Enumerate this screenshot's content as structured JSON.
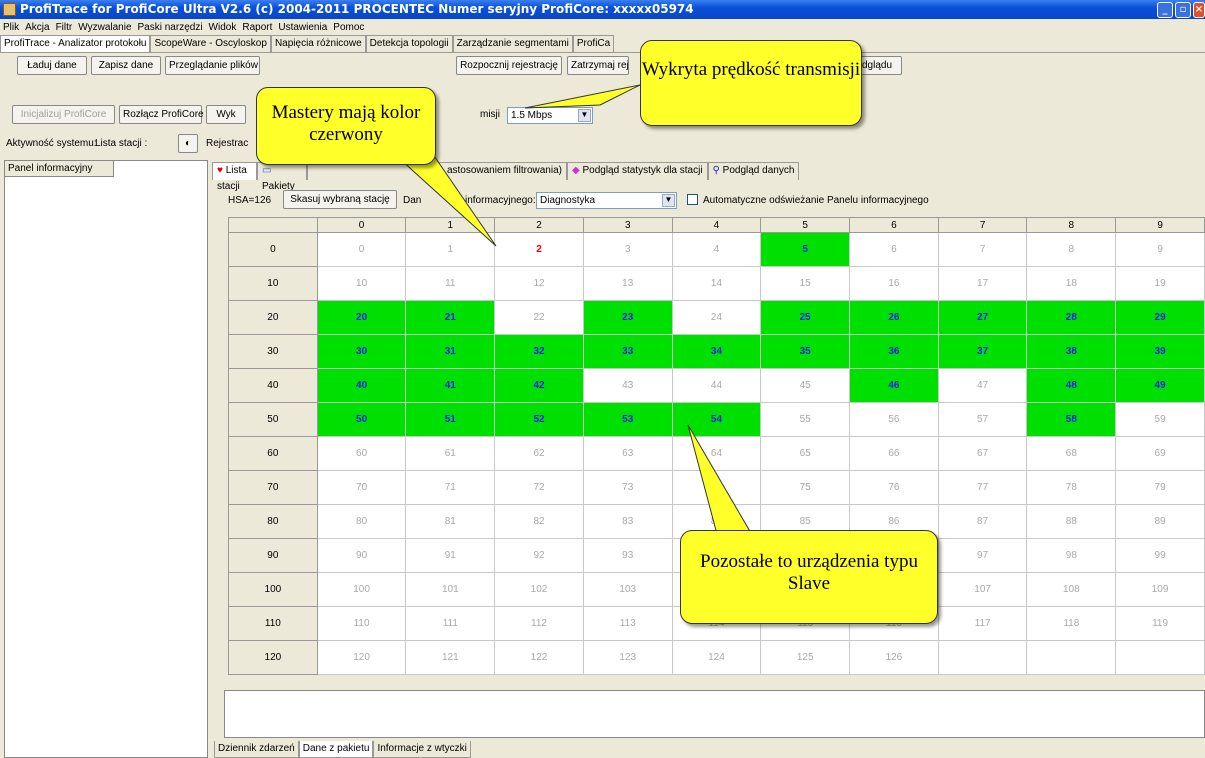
{
  "window": {
    "title": "ProfiTrace for ProfiCore Ultra V2.6 (c) 2004-2011 PROCENTEC  Numer seryjny ProfiCore: xxxxx05974"
  },
  "menu": [
    "Plik",
    "Akcja",
    "Filtr",
    "Wyzwalanie",
    "Paski narzędzi",
    "Widok",
    "Raport",
    "Ustawienia",
    "Pomoc"
  ],
  "tabs": [
    "ProfiTrace - Analizator protokołu",
    "ScopeWare - Oscyloskop",
    "Napięcia różnicowe",
    "Detekcja topologii",
    "Zarządzanie segmentami",
    "ProfiCa"
  ],
  "toolbar1": {
    "load": "Ładuj dane",
    "save": "Zapisz dane",
    "browse": "Przeglądanie plików",
    "start": "Rozpocznij rejestrację",
    "stop": "Zatrzymaj rej",
    "view": "dglądu"
  },
  "toolbar2": {
    "init": "Inicjalizuj ProfiCore",
    "disconnect": "Rozłącz ProfiCore",
    "wy": "Wyk",
    "misji": "misji",
    "speed": "1.5 Mbps"
  },
  "status": {
    "activity": "Aktywność systemu:",
    "stations": "Lista stacji :",
    "reg": "Rejestrac"
  },
  "leftpanel": {
    "title": "Panel informacyjny"
  },
  "subtabs": {
    "stations": "Lista stacji",
    "packets": "Pakiety",
    "filtered": "astosowaniem filtrowania)",
    "stats": "Podgląd statystyk dla stacji",
    "data": "Podgląd danych"
  },
  "hsa": {
    "label": "HSA=126",
    "delete": "Skasuj wybraną stację",
    "info_a": "Dan",
    "info_b": "informacyjnego:",
    "mode": "Diagnostyka",
    "auto": "Automatyczne odświeżanie Panelu informacyjnego"
  },
  "grid": {
    "col_headers": [
      "0",
      "1",
      "2",
      "3",
      "4",
      "5",
      "6",
      "7",
      "8",
      "9"
    ],
    "row_headers": [
      "0",
      "10",
      "20",
      "30",
      "40",
      "50",
      "60",
      "70",
      "80",
      "90",
      "100",
      "110",
      "120"
    ],
    "max_station": 126,
    "active": [
      5,
      20,
      21,
      23,
      25,
      26,
      27,
      28,
      29,
      30,
      31,
      32,
      33,
      34,
      35,
      36,
      37,
      38,
      39,
      40,
      41,
      42,
      46,
      48,
      49,
      50,
      51,
      52,
      53,
      54,
      58
    ],
    "masters": [
      2
    ]
  },
  "bottomtabs": [
    "Dziennik zdarzeń",
    "Dane z pakietu",
    "Informacje z wtyczki"
  ],
  "callouts": {
    "speed": "Wykryta prędkość transmisji",
    "masters": "Mastery mają kolor czerwony",
    "slaves": "Pozostałe to urządzenia typu Slave"
  }
}
